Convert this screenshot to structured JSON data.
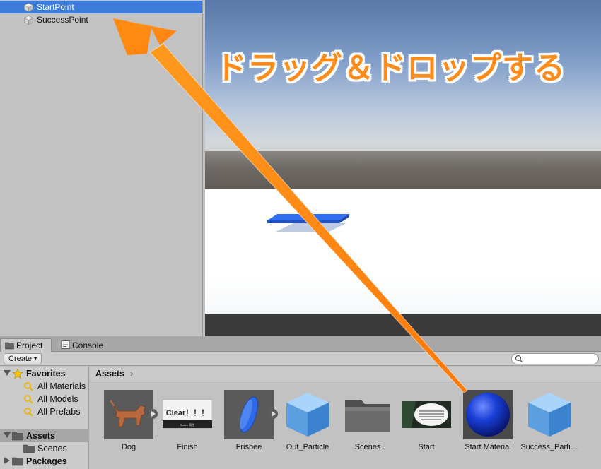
{
  "hierarchy": {
    "items": [
      {
        "label": "StartPoint",
        "selected": true,
        "icon": "cube-icon"
      },
      {
        "label": "SuccessPoint",
        "selected": false,
        "icon": "cube-icon"
      }
    ]
  },
  "overlay": {
    "title": "ドラッグ＆ドロップする",
    "color": "#ff8c1a"
  },
  "project_panel": {
    "tabs": [
      {
        "label": "Project",
        "icon": "folder-icon",
        "active": true
      },
      {
        "label": "Console",
        "icon": "console-icon",
        "active": false
      }
    ],
    "create_label": "Create",
    "tree": {
      "favorites": {
        "label": "Favorites",
        "items": [
          "All Materials",
          "All Models",
          "All Prefabs"
        ]
      },
      "assets_label": "Assets",
      "scenes_label": "Scenes",
      "packages_label": "Packages"
    },
    "breadcrumb": "Assets",
    "assets": [
      {
        "label": "Dog",
        "kind": "model",
        "icon": "dog-model-icon"
      },
      {
        "label": "Finish",
        "kind": "image",
        "icon": "clear-image-icon",
        "thumb_text": "Clear！！！",
        "thumb_subtext": "Space 再生"
      },
      {
        "label": "Frisbee",
        "kind": "model",
        "icon": "frisbee-model-icon"
      },
      {
        "label": "Out_Particle",
        "kind": "prefab",
        "icon": "prefab-cube-icon"
      },
      {
        "label": "Scenes",
        "kind": "folder",
        "icon": "folder-icon"
      },
      {
        "label": "Start",
        "kind": "image",
        "icon": "start-image-icon"
      },
      {
        "label": "Start Material",
        "kind": "material",
        "icon": "material-sphere-icon"
      },
      {
        "label": "Success_Parti…",
        "kind": "prefab",
        "icon": "prefab-cube-icon"
      }
    ]
  },
  "colors": {
    "selection_blue": "#3d7cdb",
    "material_blue": "#1a3fd6",
    "arrow_orange": "#ff8a12"
  }
}
